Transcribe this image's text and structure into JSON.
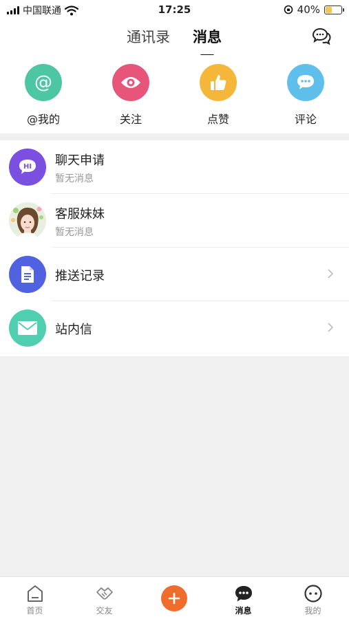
{
  "status_bar": {
    "carrier": "中国联通",
    "time": "17:25",
    "battery": "40%",
    "battery_level": 0.4
  },
  "header": {
    "tabs": [
      {
        "label": "通讯录",
        "active": false
      },
      {
        "label": "消息",
        "active": true
      }
    ],
    "action_icon": "chat-bubbles-icon"
  },
  "quick_actions": [
    {
      "label": "@我的",
      "icon": "at-icon",
      "color": "#4cc6a3"
    },
    {
      "label": "关注",
      "icon": "eye-icon",
      "color": "#e8557a"
    },
    {
      "label": "点赞",
      "icon": "thumbs-up-icon",
      "color": "#f4b73a"
    },
    {
      "label": "评论",
      "icon": "comment-icon",
      "color": "#5ec0ea"
    }
  ],
  "messages": [
    {
      "title": "聊天申请",
      "subtitle": "暂无消息",
      "icon": "hi-chat-icon",
      "color": "#7b4fe0"
    },
    {
      "title": "客服妹妹",
      "subtitle": "暂无消息",
      "icon": "avatar"
    },
    {
      "title": "推送记录",
      "icon": "document-icon",
      "color": "#5062e0"
    },
    {
      "title": "站内信",
      "icon": "mail-icon",
      "color": "#4fcfb0"
    }
  ],
  "tab_bar": [
    {
      "label": "首页",
      "icon": "home-icon",
      "active": false
    },
    {
      "label": "交友",
      "icon": "handshake-icon",
      "active": false
    },
    {
      "label": "",
      "icon": "plus-icon",
      "active": false
    },
    {
      "label": "消息",
      "icon": "message-icon",
      "active": true
    },
    {
      "label": "我的",
      "icon": "profile-icon",
      "active": false
    }
  ],
  "colors": {
    "accent": "#ef6c2b",
    "background": "#f0f0f0"
  }
}
